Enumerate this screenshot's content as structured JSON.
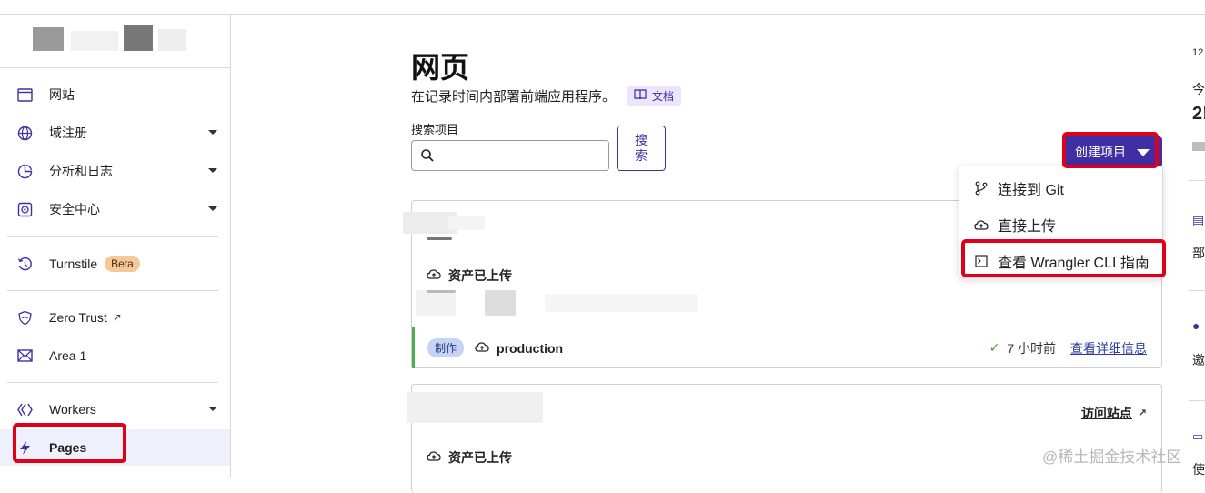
{
  "sidebar": {
    "items": [
      {
        "label": "网站",
        "icon": "browser-window-icon"
      },
      {
        "label": "域注册",
        "icon": "globe-icon"
      },
      {
        "label": "分析和日志",
        "icon": "analytics-icon"
      },
      {
        "label": "安全中心",
        "icon": "security-center-icon"
      },
      {
        "label": "Turnstile",
        "icon": "turnstile-icon",
        "badge": "Beta"
      },
      {
        "label": "Zero Trust",
        "icon": "zero-trust-icon"
      },
      {
        "label": "Area 1",
        "icon": "mail-icon"
      },
      {
        "label": "Workers",
        "icon": "workers-icon"
      },
      {
        "label": "Pages",
        "icon": "pages-icon"
      }
    ]
  },
  "page": {
    "title": "网页",
    "subtitle": "在记录时间内部署前端应用程序。",
    "docs_label": "文档",
    "search_label": "搜索项目",
    "search_placeholder": "",
    "search_button": "搜\n索",
    "create_button": "创建项目"
  },
  "dropdown": {
    "items": [
      {
        "label": "连接到 Git",
        "icon": "git-branch-icon"
      },
      {
        "label": "直接上传",
        "icon": "cloud-upload-icon"
      },
      {
        "label": "查看 Wrangler CLI 指南",
        "icon": "terminal-icon"
      }
    ]
  },
  "projects": [
    {
      "assets_label": "资产已上传",
      "env_badge": "制作",
      "branch": "production",
      "time": "7 小时前",
      "details_link": "查看详细信息"
    },
    {
      "visit_link": "访问站点",
      "assets_label": "资产已上传"
    }
  ],
  "right_column": {
    "texts": [
      "12",
      "今",
      "2!",
      "部",
      "邀",
      "使"
    ]
  },
  "watermark": "@稀土掘金技术社区",
  "colors": {
    "accent": "#3e2fa4",
    "highlight_red": "#e0001b",
    "success_green": "#4caf50",
    "beta_badge": "#f4c898"
  }
}
